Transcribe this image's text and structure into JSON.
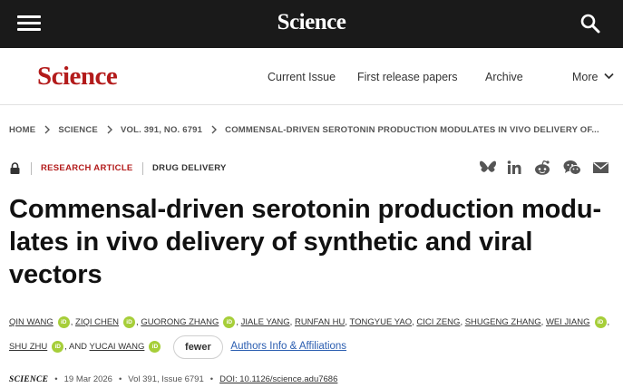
{
  "header": {
    "logo": "Science",
    "menu_icon": "hamburger-menu-icon",
    "search_icon": "search-icon"
  },
  "nav": {
    "logo": "Science",
    "links": [
      "Current Issue",
      "First release papers",
      "Archive"
    ],
    "more_label": "More"
  },
  "breadcrumb": [
    "HOME",
    "SCIENCE",
    "VOL. 391, NO. 6791",
    "COMMENSAL-DRIVEN SEROTONIN PRODUCTION MODULATES IN VIVO DELIVERY OF..."
  ],
  "article": {
    "type": "RESEARCH ARTICLE",
    "subject": "DRUG DELIVERY",
    "title": "Commensal-driven serotonin production modu-lates in vivo delivery of synthetic and viral vectors",
    "share_icons": [
      "bluesky-icon",
      "linkedin-icon",
      "reddit-icon",
      "wechat-icon",
      "email-icon"
    ]
  },
  "authors": {
    "names": [
      "QIN WANG",
      "ZIQI CHEN",
      "GUORONG ZHANG",
      "JIALE YANG",
      "RUNFAN HU",
      "TONGYUE YAO",
      "CICI ZENG",
      "SHUGENG ZHANG",
      "WEI JIANG",
      "SHU ZHU",
      "YUCAI WANG"
    ],
    "and_label": ", AND",
    "orcid_label": "iD",
    "fewer_label": "fewer",
    "affiliations_label": "Authors Info & Affiliations"
  },
  "citation": {
    "journal": "SCIENCE",
    "date": "19 Mar 2026",
    "volume_issue": "Vol 391, Issue 6791",
    "doi": "DOI: 10.1126/science.adu7686"
  },
  "colors": {
    "brand_red": "#b31b1b",
    "link_blue": "#2a5db0",
    "orcid_green": "#a6ce39",
    "topbar": "#1a1a1a"
  }
}
